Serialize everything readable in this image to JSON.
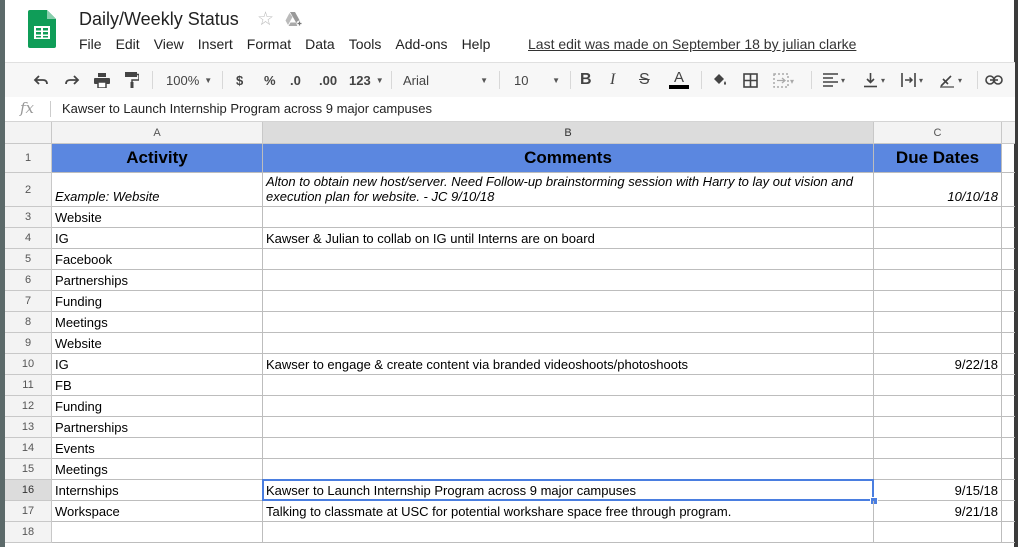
{
  "doc": {
    "title": "Daily/Weekly Status",
    "last_edit": "Last edit was made on September 18 by julian clarke"
  },
  "menu": [
    "File",
    "Edit",
    "View",
    "Insert",
    "Format",
    "Data",
    "Tools",
    "Add-ons",
    "Help"
  ],
  "toolbar": {
    "zoom": "100%",
    "currency": "$",
    "percent": "%",
    "dec_decrease": ".0",
    "dec_increase": ".00",
    "more_formats": "123",
    "font": "Arial",
    "font_size": "10"
  },
  "formula_bar": {
    "fx": "fx",
    "content": "Kawser to Launch Internship Program across 9 major campuses"
  },
  "columns": [
    "A",
    "B",
    "C"
  ],
  "rows": [
    {
      "num": "1",
      "a": "Activity",
      "b": "Comments",
      "c": "Due Dates"
    },
    {
      "num": "2",
      "a": "Example: Website",
      "b": "Alton to obtain new host/server. Need Follow-up brainstorming session with Harry to lay out vision and execution plan for website. - JC 9/10/18",
      "c": "10/10/18"
    },
    {
      "num": "3",
      "a": "Website",
      "b": "",
      "c": ""
    },
    {
      "num": "4",
      "a": "IG",
      "b": "Kawser & Julian to collab on IG until Interns are on board",
      "c": ""
    },
    {
      "num": "5",
      "a": "Facebook",
      "b": "",
      "c": ""
    },
    {
      "num": "6",
      "a": "Partnerships",
      "b": "",
      "c": ""
    },
    {
      "num": "7",
      "a": "Funding",
      "b": "",
      "c": ""
    },
    {
      "num": "8",
      "a": "Meetings",
      "b": "",
      "c": ""
    },
    {
      "num": "9",
      "a": "Website",
      "b": "",
      "c": ""
    },
    {
      "num": "10",
      "a": "IG",
      "b": "Kawser to engage & create content via branded videoshoots/photoshoots",
      "c": "9/22/18"
    },
    {
      "num": "11",
      "a": "FB",
      "b": "",
      "c": ""
    },
    {
      "num": "12",
      "a": "Funding",
      "b": "",
      "c": ""
    },
    {
      "num": "13",
      "a": "Partnerships",
      "b": "",
      "c": ""
    },
    {
      "num": "14",
      "a": "Events",
      "b": "",
      "c": ""
    },
    {
      "num": "15",
      "a": "Meetings",
      "b": "",
      "c": ""
    },
    {
      "num": "16",
      "a": "Internships",
      "b": "Kawser to Launch Internship Program across 9 major campuses",
      "c": "9/15/18"
    },
    {
      "num": "17",
      "a": "Workspace",
      "b": "Talking to classmate at USC for potential workshare space free through program.",
      "c": "9/21/18"
    },
    {
      "num": "18",
      "a": "",
      "b": "",
      "c": ""
    }
  ],
  "colors": {
    "header_fill": "#5b87e0",
    "selection": "#4a7ee0",
    "sheets_green": "#0f9d58"
  }
}
